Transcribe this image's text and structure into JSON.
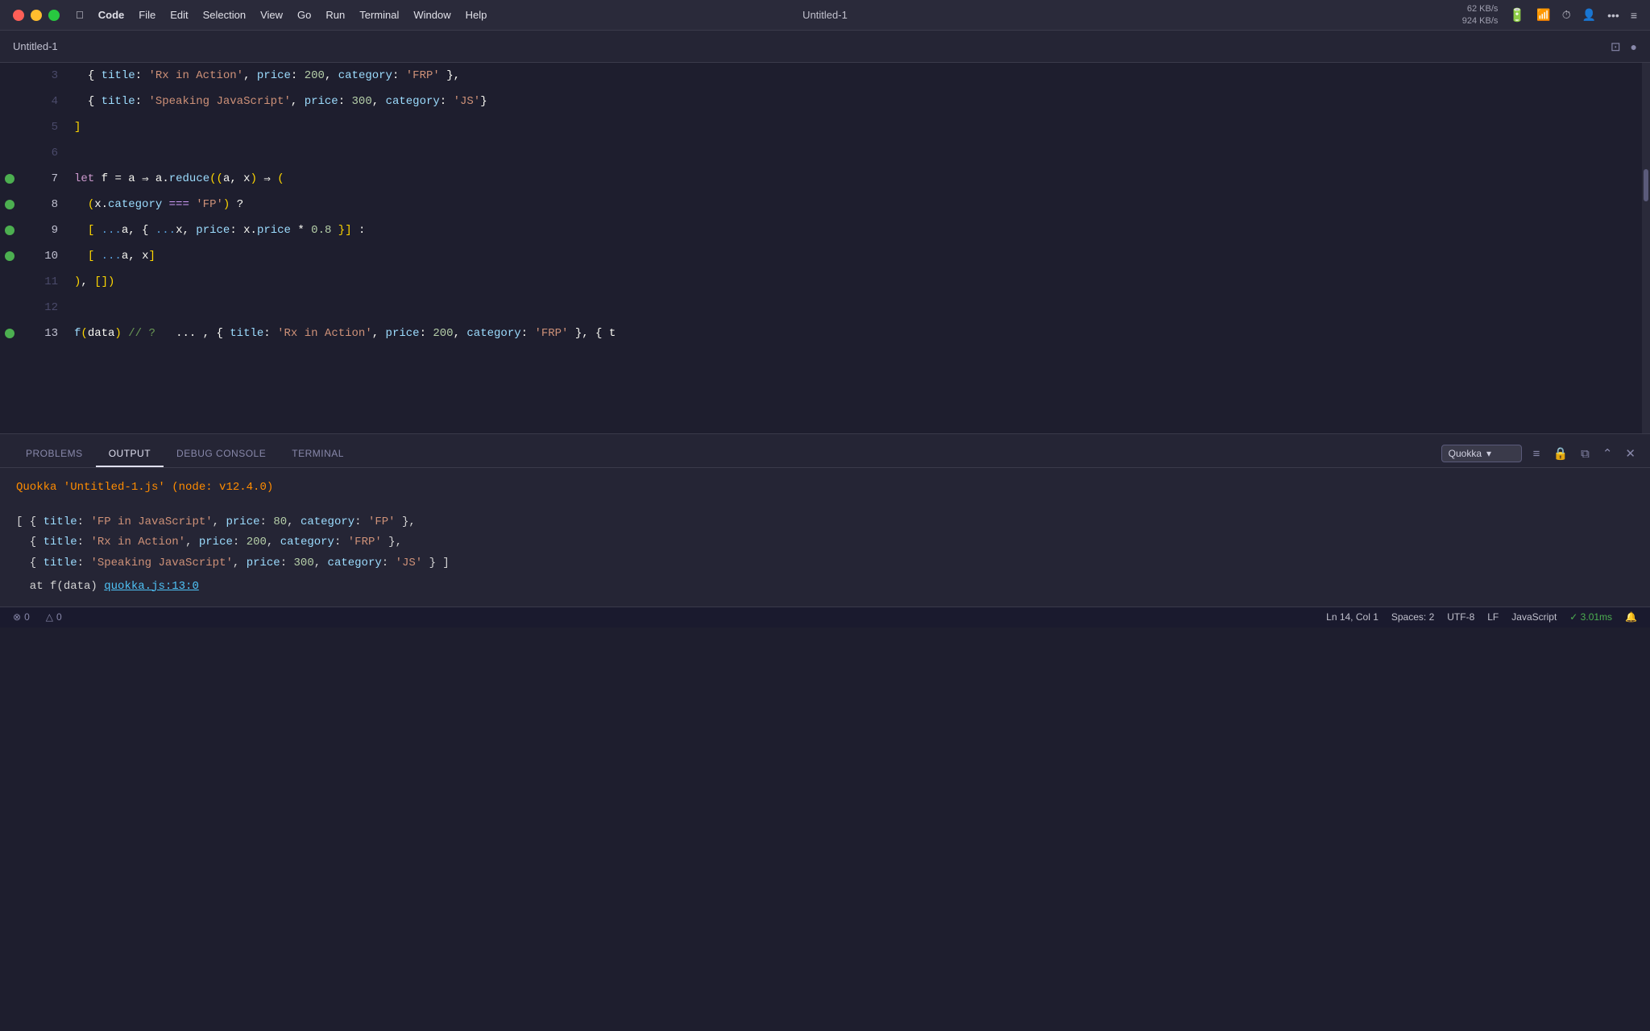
{
  "titleBar": {
    "appName": "Code",
    "menus": [
      "●",
      "Code",
      "File",
      "Edit",
      "Selection",
      "View",
      "Go",
      "Run",
      "Terminal",
      "Window",
      "Help"
    ],
    "windowTitle": "Untitled-1",
    "networkSpeed": "62 KB/s\n924 KB/s",
    "layoutIcon": "⊞",
    "circleIcon": "●"
  },
  "tabBar": {
    "title": "Untitled-1"
  },
  "editor": {
    "lines": [
      {
        "num": "3",
        "bp": false,
        "code": "  { title: 'Rx in Action', price: 200, category: 'FRP' },"
      },
      {
        "num": "4",
        "bp": false,
        "code": "  { title: 'Speaking JavaScript', price: 300, category: 'JS' }"
      },
      {
        "num": "5",
        "bp": false,
        "code": "]"
      },
      {
        "num": "6",
        "bp": false,
        "code": ""
      },
      {
        "num": "7",
        "bp": true,
        "code": "let f = a => a.reduce((a, x) => ("
      },
      {
        "num": "8",
        "bp": true,
        "code": "  (x.category === 'FP') ?"
      },
      {
        "num": "9",
        "bp": true,
        "code": "  [ ...a, { ...x, price: x.price * 0.8 }] :"
      },
      {
        "num": "10",
        "bp": true,
        "code": "  [ ...a, x]"
      },
      {
        "num": "11",
        "bp": false,
        "code": "), [])"
      },
      {
        "num": "12",
        "bp": false,
        "code": ""
      },
      {
        "num": "13",
        "bp": true,
        "code": "f(data) // ?   ... , { title: 'Rx in Action', price: 200, category: 'FRP' }, { t"
      }
    ]
  },
  "panel": {
    "tabs": [
      "PROBLEMS",
      "OUTPUT",
      "DEBUG CONSOLE",
      "TERMINAL"
    ],
    "activeTab": "OUTPUT",
    "dropdown": "Quokka",
    "outputLines": [
      {
        "type": "header",
        "text": "Quokka 'Untitled-1.js' (node: v12.4.0)"
      },
      {
        "type": "blank",
        "text": ""
      },
      {
        "type": "data",
        "text": "[ { title: 'FP in JavaScript', price: 80, category: 'FP' },"
      },
      {
        "type": "data",
        "text": "  { title: 'Rx in Action', price: 200, category: 'FRP' },"
      },
      {
        "type": "data",
        "text": "  { title: 'Speaking JavaScript', price: 300, category: 'JS' } ]"
      },
      {
        "type": "at",
        "text": "  at f(data) quokka.js:13:0"
      }
    ]
  },
  "statusBar": {
    "errorIcon": "⊗",
    "errorCount": "0",
    "warnIcon": "△",
    "warnCount": "0",
    "position": "Ln 14, Col 1",
    "spaces": "Spaces: 2",
    "encoding": "UTF-8",
    "eol": "LF",
    "language": "JavaScript",
    "timing": "✓ 3.01ms",
    "notifIcon": "🔔"
  }
}
